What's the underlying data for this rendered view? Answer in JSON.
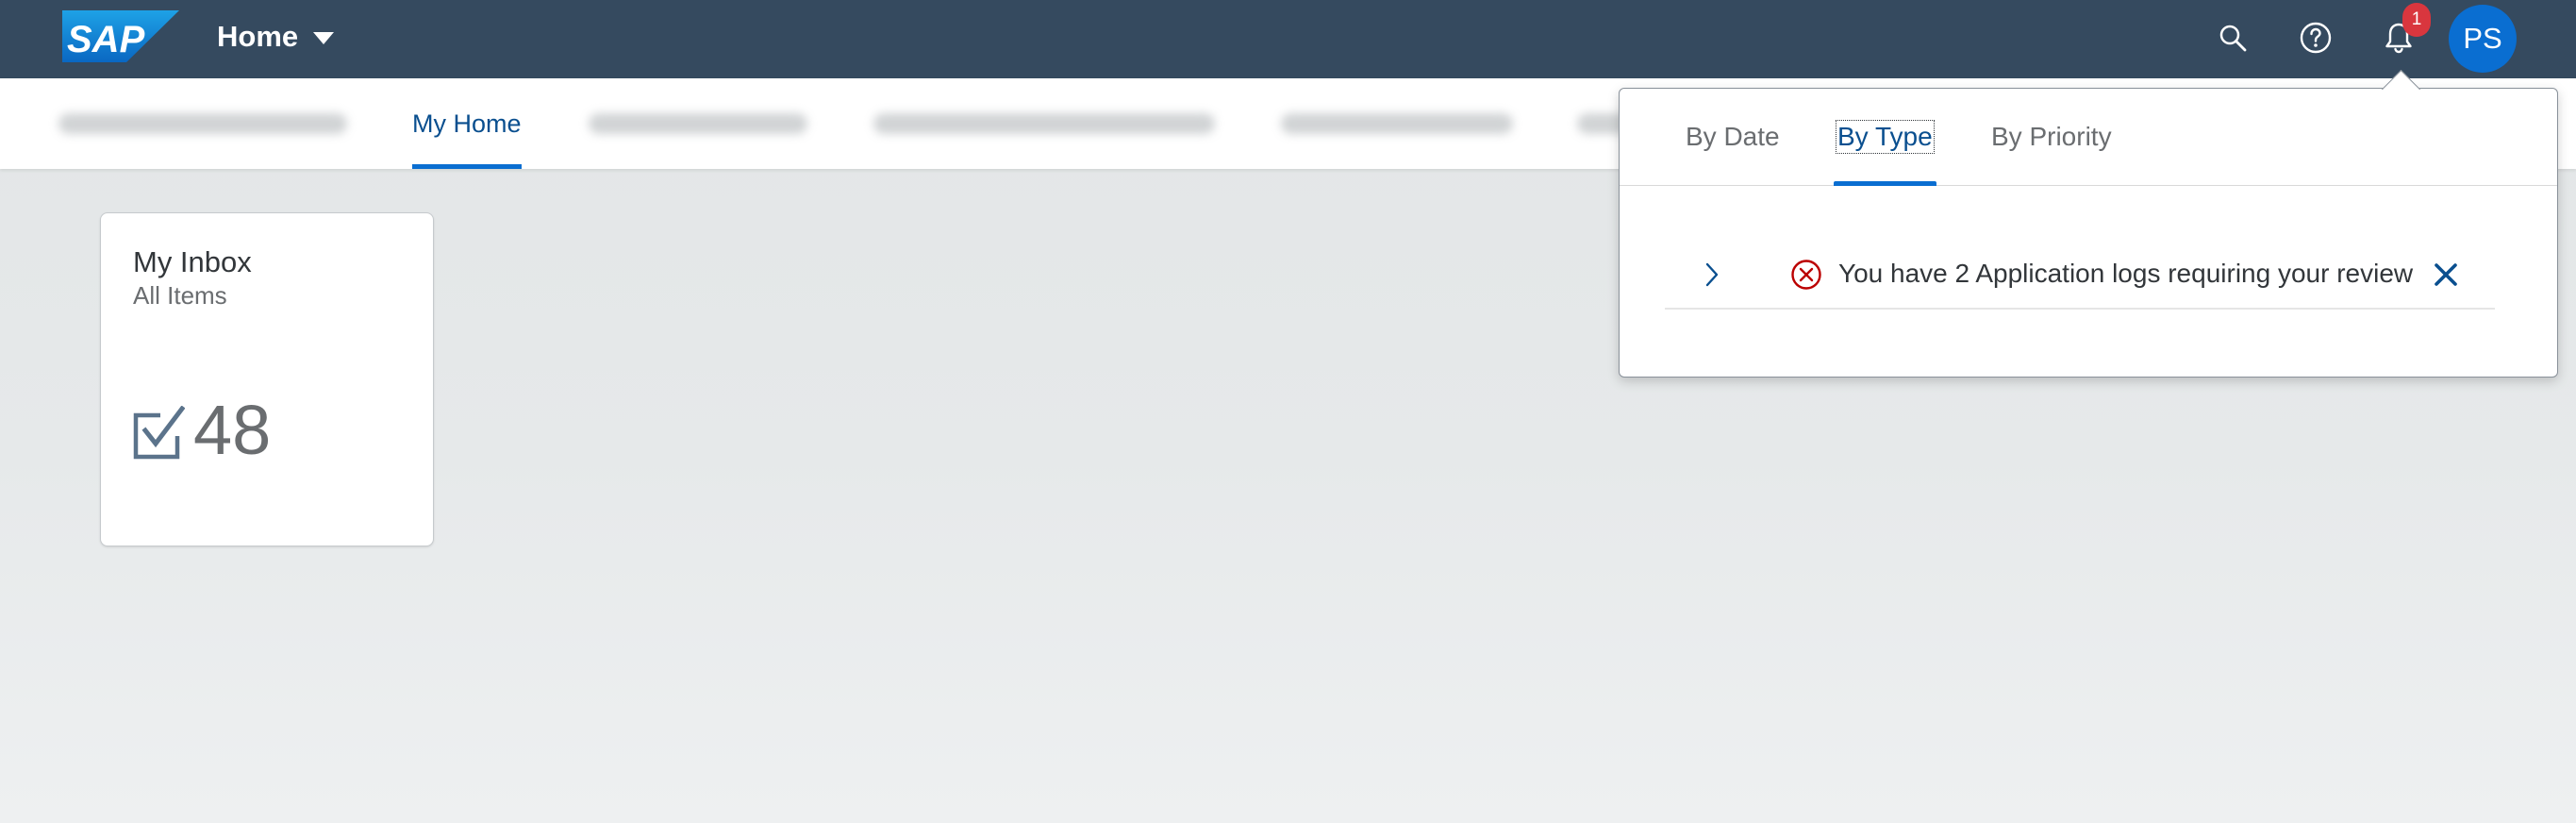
{
  "shell": {
    "logo_text": "SAP",
    "home_label": "Home",
    "notification_count": "1",
    "user_initials": "PS"
  },
  "anchor_bar": {
    "active_label": "My Home"
  },
  "tile": {
    "title": "My Inbox",
    "subtitle": "All Items",
    "count": "48",
    "icon": "task-check-icon"
  },
  "notifications": {
    "tabs": [
      {
        "label": "By Date"
      },
      {
        "label": "By Type"
      },
      {
        "label": "By Priority"
      }
    ],
    "selected_tab": "By Type",
    "items": [
      {
        "text": "You have 2 Application logs requiring your review",
        "severity": "error"
      }
    ]
  },
  "colors": {
    "shell_background": "#354a5f",
    "accent": "#0a6ed1",
    "badge": "#d9363e",
    "error": "#bb0000"
  }
}
